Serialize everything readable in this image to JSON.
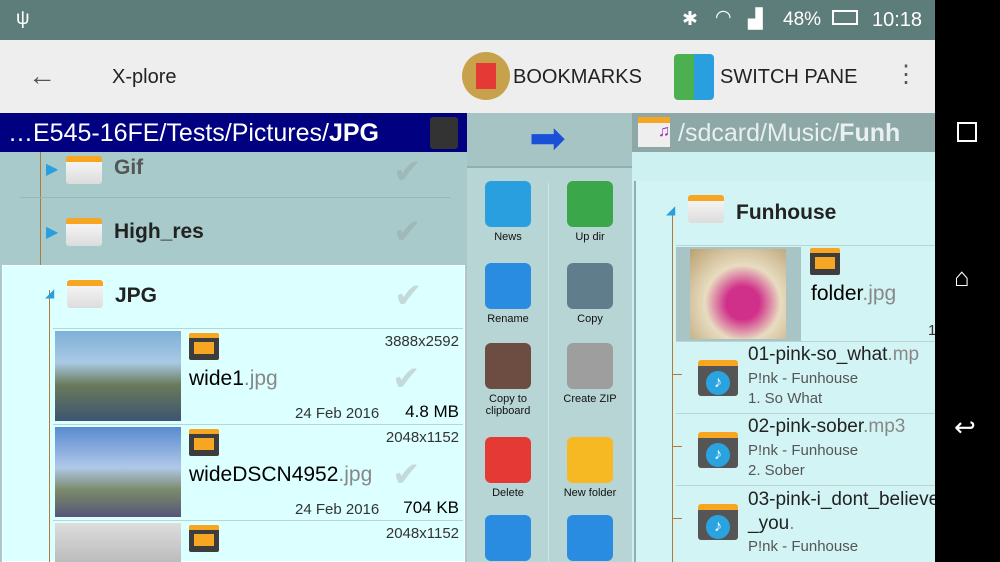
{
  "status": {
    "battery": "48%",
    "time": "10:18",
    "usb_icon": "usb-icon",
    "bluetooth_icon": "bluetooth-icon",
    "wifi_icon": "wifi-icon",
    "signal_icon": "signal-icon",
    "battery_icon": "battery-icon"
  },
  "toolbar": {
    "title": "X-plore",
    "bookmarks": "BOOKMARKS",
    "switch_pane": "SWITCH PANE"
  },
  "left": {
    "path_prefix": "…E545-16FE/Tests/Pictures/",
    "path_current": "JPG",
    "folders": [
      {
        "name": "Gif"
      },
      {
        "name": "High_res"
      },
      {
        "name": "JPG"
      }
    ],
    "files": [
      {
        "name": "wide1",
        "ext": ".jpg",
        "resolution": "3888x2592",
        "date": "24 Feb 2016",
        "size": "4.8 MB"
      },
      {
        "name": "wideDSCN4952",
        "ext": ".jpg",
        "resolution": "2048x1152",
        "date": "24 Feb 2016",
        "size": "704 KB"
      },
      {
        "name": "",
        "ext": "",
        "resolution": "2048x1152",
        "date": "",
        "size": ""
      }
    ]
  },
  "tools": [
    {
      "label": "News",
      "color": "#2a9fe0"
    },
    {
      "label": "Up dir",
      "color": "#3aa84a"
    },
    {
      "label": "Rename",
      "color": "#2a8ce0"
    },
    {
      "label": "Copy",
      "color": "#607d8b"
    },
    {
      "label": "Copy to clipboard",
      "color": "#6d4c41"
    },
    {
      "label": "Create ZIP",
      "color": "#9e9e9e"
    },
    {
      "label": "Delete",
      "color": "#e53935"
    },
    {
      "label": "New folder",
      "color": "#f6b823"
    },
    {
      "label": "",
      "color": "#2a8ce0"
    },
    {
      "label": "",
      "color": "#2a8ce0"
    }
  ],
  "right": {
    "path_prefix": "/sdcard/Music/",
    "path_current": "Funh",
    "folder": "Funhouse",
    "files": [
      {
        "name": "folder",
        "ext": ".jpg",
        "line1": "",
        "line2": "",
        "size": "1"
      },
      {
        "name": "01-pink-so_what",
        "ext": ".mp",
        "line1": "P!nk - Funhouse",
        "line2": "1.  So What"
      },
      {
        "name": "02-pink-sober",
        "ext": ".mp3",
        "line1": "P!nk - Funhouse",
        "line2": "2.  Sober"
      },
      {
        "name": "03-pink-i_dont_believe_you",
        "ext": ".",
        "line1": "P!nk - Funhouse",
        "line2": ""
      }
    ]
  },
  "colors": {
    "path_bar": "#000080",
    "accent": "#2a9fe0",
    "folder": "#f6a623"
  }
}
